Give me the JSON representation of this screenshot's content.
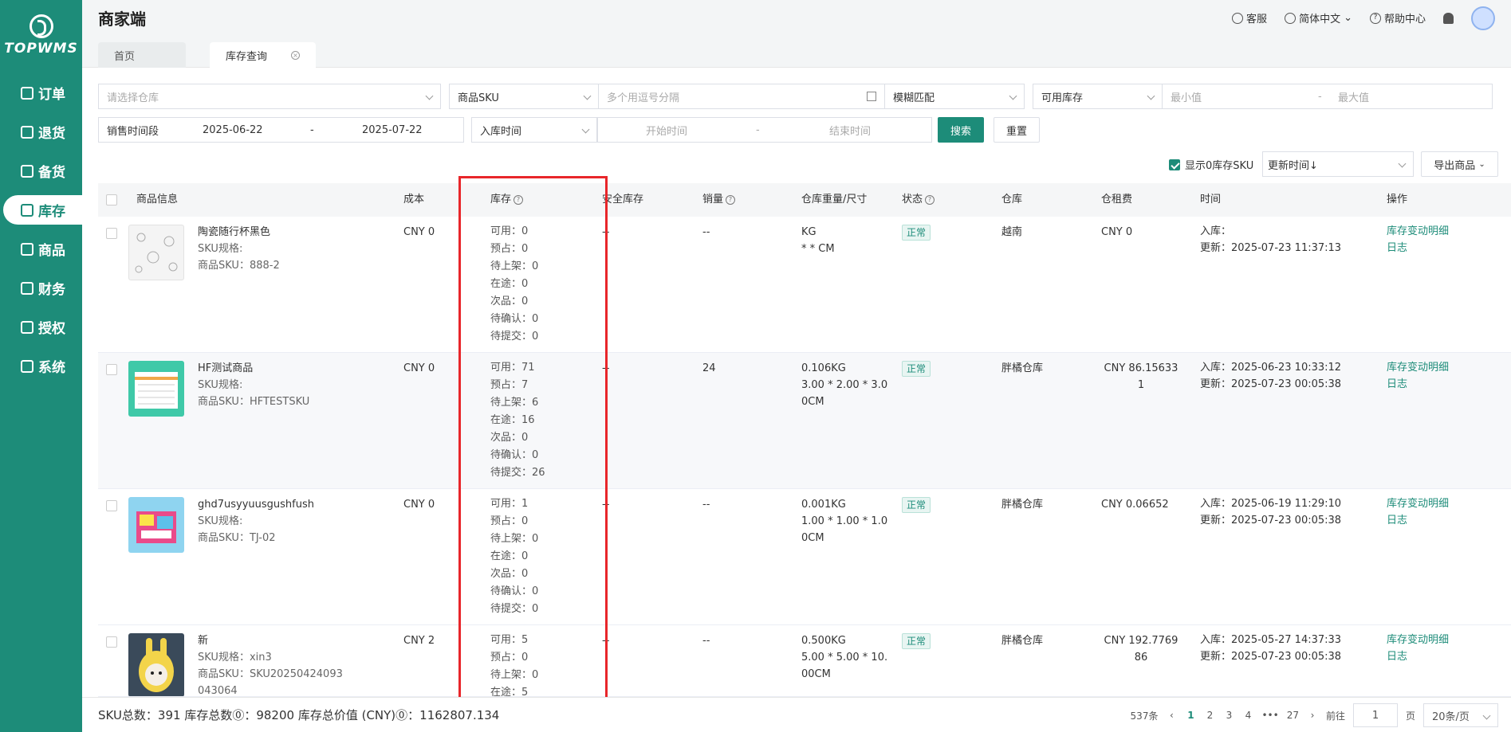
{
  "brand": {
    "name": "TOPWMS"
  },
  "sidebar": {
    "items": [
      {
        "label": "订单",
        "icon": "order-icon"
      },
      {
        "label": "退货",
        "icon": "return-icon"
      },
      {
        "label": "备货",
        "icon": "stock-prep-icon"
      },
      {
        "label": "库存",
        "icon": "inventory-icon",
        "active": true
      },
      {
        "label": "商品",
        "icon": "product-icon"
      },
      {
        "label": "财务",
        "icon": "finance-icon"
      },
      {
        "label": "授权",
        "icon": "auth-icon"
      },
      {
        "label": "系统",
        "icon": "system-icon"
      }
    ]
  },
  "header": {
    "title": "商家端",
    "service": "客服",
    "language": "简体中文",
    "help": "帮助中心"
  },
  "tabs": [
    {
      "label": "首页"
    },
    {
      "label": "库存查询",
      "active": true
    }
  ],
  "filters": {
    "warehouse_placeholder": "请选择仓库",
    "sku_type": "商品SKU",
    "sku_placeholder": "多个用逗号分隔",
    "match_mode": "模糊匹配",
    "stock_type": "可用库存",
    "min_placeholder": "最小值",
    "max_placeholder": "最大值",
    "range_sep": "-",
    "sales_period_label": "销售时间段",
    "sales_start": "2025-06-22",
    "sales_end": "2025-07-22",
    "date_type": "入库时间",
    "start_placeholder": "开始时间",
    "end_placeholder": "结束时间",
    "search_label": "搜索",
    "reset_label": "重置",
    "show_zero_label": "显示0库存SKU",
    "sort_label": "更新时间↓",
    "export_label": "导出商品"
  },
  "table": {
    "headers": {
      "product": "商品信息",
      "cost": "成本",
      "stock": "库存",
      "safety": "安全库存",
      "sales": "销量",
      "weight": "仓库重量/尺寸",
      "status": "状态",
      "warehouse": "仓库",
      "rent": "仓租费",
      "time": "时间",
      "ops": "操作"
    },
    "rows": [
      {
        "name": "陶瓷随行杯黑色",
        "spec": "SKU规格:",
        "sku": "商品SKU：888-2",
        "cost": "CNY 0",
        "stock": [
          "可用：0",
          "预占：0",
          "待上架：0",
          "在途：0",
          "次品：0",
          "待确认：0",
          "待提交：0"
        ],
        "safety": "--",
        "sales": "--",
        "weight": "KG",
        "size": "* * CM",
        "status": "正常",
        "warehouse": "越南",
        "rent": "CNY 0",
        "inbound": "入库：",
        "updated": "更新：2025-07-23 11:37:13",
        "op1": "库存变动明细",
        "op2": "日志"
      },
      {
        "name": "HF测试商品",
        "spec": "SKU规格:",
        "sku": "商品SKU：HFTESTSKU",
        "cost": "CNY 0",
        "stock": [
          "可用：71",
          "预占：7",
          "待上架：6",
          "在途：16",
          "次品：0",
          "待确认：0",
          "待提交：26"
        ],
        "safety": "--",
        "sales": "24",
        "weight": "0.106KG",
        "size": "3.00 * 2.00 * 3.00CM",
        "status": "正常",
        "warehouse": "胖橘仓库",
        "rent": "CNY 86.156331",
        "inbound": "入库：2025-06-23 10:33:12",
        "updated": "更新：2025-07-23 00:05:38",
        "op1": "库存变动明细",
        "op2": "日志"
      },
      {
        "name": "ghd7usyyuusgushfush",
        "spec": "SKU规格:",
        "sku": "商品SKU：TJ-02",
        "cost": "CNY 0",
        "stock": [
          "可用：1",
          "预占：0",
          "待上架：0",
          "在途：0",
          "次品：0",
          "待确认：0",
          "待提交：0"
        ],
        "safety": "--",
        "sales": "--",
        "weight": "0.001KG",
        "size": "1.00 * 1.00 * 1.00CM",
        "status": "正常",
        "warehouse": "胖橘仓库",
        "rent": "CNY 0.06652",
        "inbound": "入库：2025-06-19 11:29:10",
        "updated": "更新：2025-07-23 00:05:38",
        "op1": "库存变动明细",
        "op2": "日志"
      },
      {
        "name": "新",
        "spec": "SKU规格：xin3",
        "sku": "商品SKU：SKU20250424093043064",
        "cost": "CNY 2",
        "stock": [
          "可用：5",
          "预占：0",
          "待上架：0",
          "在途：5"
        ],
        "safety": "--",
        "sales": "--",
        "weight": "0.500KG",
        "size": "5.00 * 5.00 * 10.00CM",
        "status": "正常",
        "warehouse": "胖橘仓库",
        "rent": "CNY 192.776986",
        "inbound": "入库：2025-05-27 14:37:33",
        "updated": "更新：2025-07-23 00:05:38",
        "op1": "库存变动明细",
        "op2": "日志"
      }
    ]
  },
  "footer": {
    "summary": "SKU总数：391  库存总数⓪：98200  库存总价值 (CNY)⓪：1162807.134",
    "total": "537条",
    "pages": [
      "1",
      "2",
      "3",
      "4",
      "•••",
      "27"
    ],
    "goto_label": "前往",
    "goto_value": "1",
    "page_unit": "页",
    "page_size": "20条/页"
  }
}
